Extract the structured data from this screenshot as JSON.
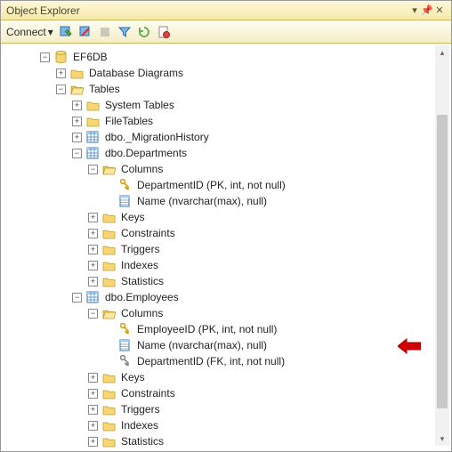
{
  "title": "Object Explorer",
  "toolbar": {
    "connect": "Connect"
  },
  "tree": {
    "db": "EF6DB",
    "diagrams": "Database Diagrams",
    "tables": "Tables",
    "system_tables": "System Tables",
    "file_tables": "FileTables",
    "migration": "dbo._MigrationHistory",
    "departments": "dbo.Departments",
    "columns": "Columns",
    "dep_id": "DepartmentID (PK, int, not null)",
    "dep_name": "Name (nvarchar(max), null)",
    "keys": "Keys",
    "constraints": "Constraints",
    "triggers": "Triggers",
    "indexes": "Indexes",
    "statistics": "Statistics",
    "employees": "dbo.Employees",
    "emp_id": "EmployeeID (PK, int, not null)",
    "emp_name": "Name (nvarchar(max), null)",
    "emp_dep": "DepartmentID (FK, int, not null)"
  }
}
